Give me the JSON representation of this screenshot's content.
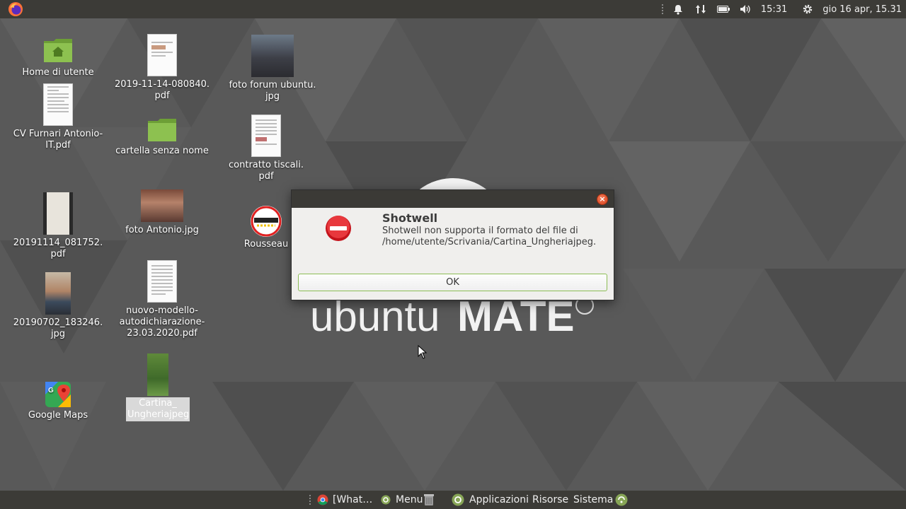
{
  "top_panel": {
    "time": "15:31",
    "datetime": "gio 16 apr, 15.31",
    "icons": [
      "firefox-icon",
      "notification-bell-icon",
      "network-arrows-icon",
      "battery-icon",
      "volume-icon",
      "settings-gear-icon"
    ]
  },
  "desktop": {
    "icons": [
      {
        "label": "Home di utente",
        "type": "folder-home"
      },
      {
        "label": "CV Furnari Antonio-\nIT.pdf",
        "type": "pdf"
      },
      {
        "label": "20191114_081752.\npdf",
        "type": "pdf"
      },
      {
        "label": "20190702_183246.\njpg",
        "type": "photo"
      },
      {
        "label": "Google Maps",
        "type": "app"
      },
      {
        "label": "2019-11-14-080840.\npdf",
        "type": "pdf"
      },
      {
        "label": "cartella senza nome",
        "type": "folder"
      },
      {
        "label": "foto Antonio.jpg",
        "type": "photo"
      },
      {
        "label": "nuovo-modello-\nautodichiarazione-\n23.03.2020.pdf",
        "type": "pdf"
      },
      {
        "label": "Cartina_\nUngheriajpeg",
        "type": "image",
        "selected": true
      },
      {
        "label": "foto forum ubuntu.\njpg",
        "type": "photo"
      },
      {
        "label": "contratto tiscali.\npdf",
        "type": "pdf"
      },
      {
        "label": "Rousseau",
        "type": "app"
      }
    ]
  },
  "wallpaper": {
    "logo_light": "ubuntu",
    "logo_bold": "MATE",
    "logo_mark": "®"
  },
  "dialog": {
    "title": "Shotwell",
    "message_line1": "Shotwell non supporta il formato del file di",
    "message_line2": "/home/utente/Scrivania/Cartina_Ungheriajpeg.",
    "ok_label": "OK",
    "accent_color": "#87a556"
  },
  "bottom_panel": {
    "task_label": "[What…",
    "menu_label": "Menu",
    "applicazioni": "Applicazioni",
    "risorse": "Risorse",
    "sistema": "Sistema"
  }
}
